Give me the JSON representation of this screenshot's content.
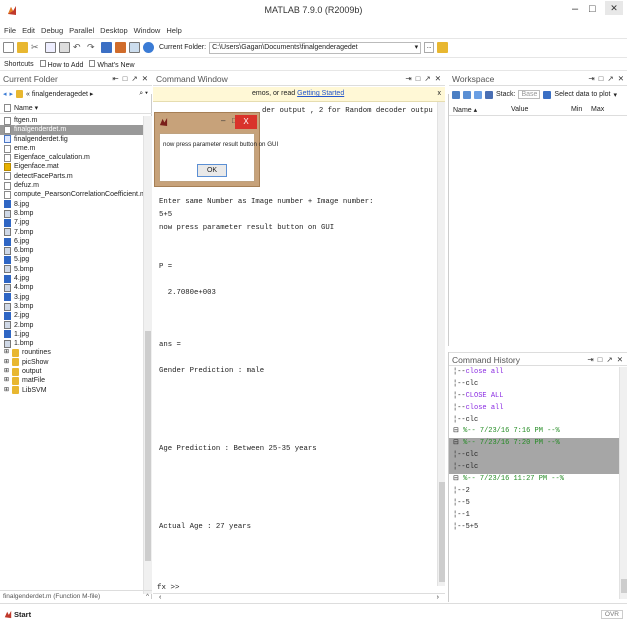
{
  "window": {
    "title": "MATLAB 7.9.0 (R2009b)",
    "controls": [
      "–",
      "□",
      "✕"
    ]
  },
  "menu": [
    "File",
    "Edit",
    "Debug",
    "Parallel",
    "Desktop",
    "Window",
    "Help"
  ],
  "toolbar": {
    "current_folder_label": "Current Folder:",
    "current_folder_value": "C:\\Users\\Gagan\\Documents\\finalgenderagedet",
    "browse_label": "..."
  },
  "shortcuts": [
    "Shortcuts",
    "How to Add",
    "What's New"
  ],
  "current_folder": {
    "title": "Current Folder",
    "breadcrumb": "« finalgenderagedet ▸",
    "name_header": "Name ▾",
    "files": [
      {
        "name": "ftgen.m",
        "type": "m"
      },
      {
        "name": "finalgenderdet.m",
        "type": "m",
        "selected": true
      },
      {
        "name": "finalgenderdet.fig",
        "type": "fig"
      },
      {
        "name": "eme.m",
        "type": "m"
      },
      {
        "name": "Eigenface_calculation.m",
        "type": "m"
      },
      {
        "name": "Eigenface.mat",
        "type": "mat"
      },
      {
        "name": "detectFaceParts.m",
        "type": "m"
      },
      {
        "name": "defuz.m",
        "type": "m"
      },
      {
        "name": "compute_PearsonCorrelationCoefficient.m",
        "type": "m"
      },
      {
        "name": "8.jpg",
        "type": "jpg"
      },
      {
        "name": "8.bmp",
        "type": "bmp"
      },
      {
        "name": "7.jpg",
        "type": "jpg"
      },
      {
        "name": "7.bmp",
        "type": "bmp"
      },
      {
        "name": "6.jpg",
        "type": "jpg"
      },
      {
        "name": "6.bmp",
        "type": "bmp"
      },
      {
        "name": "5.jpg",
        "type": "jpg"
      },
      {
        "name": "5.bmp",
        "type": "bmp"
      },
      {
        "name": "4.jpg",
        "type": "jpg"
      },
      {
        "name": "4.bmp",
        "type": "bmp"
      },
      {
        "name": "3.jpg",
        "type": "jpg"
      },
      {
        "name": "3.bmp",
        "type": "bmp"
      },
      {
        "name": "2.jpg",
        "type": "jpg"
      },
      {
        "name": "2.bmp",
        "type": "bmp"
      },
      {
        "name": "1.jpg",
        "type": "jpg"
      },
      {
        "name": "1.bmp",
        "type": "bmp"
      },
      {
        "name": "rountines",
        "type": "dir"
      },
      {
        "name": "picShow",
        "type": "dir"
      },
      {
        "name": "output",
        "type": "dir"
      },
      {
        "name": "matFile",
        "type": "dir"
      },
      {
        "name": "LibSVM",
        "type": "dir"
      }
    ],
    "status": "finalgenderdet.m (Function M-file)"
  },
  "command_window": {
    "title": "Command Window",
    "info_line": "emos, or read",
    "info_link": "Getting Started",
    "lines": [
      "der output , 2 for Random decoder output",
      "",
      "",
      "h =",
      "",
      "  2.7040e+003",
      "",
      "Enter same Number as Image number + Image number:",
      "5+5",
      "now press parameter result button on GUI",
      "",
      "",
      "P =",
      "",
      "  2.7080e+003",
      "",
      "",
      "",
      "ans =",
      "",
      "Gender Prediction : male",
      "",
      "",
      "",
      "",
      "",
      "Age Prediction : Between 25-35 years",
      "",
      "",
      "",
      "",
      "",
      "Actual Age : 27 years"
    ],
    "prompt": "fx >>"
  },
  "dialog": {
    "message": "now press parameter result button on GUI",
    "ok_label": "OK",
    "close_label": "X"
  },
  "workspace": {
    "title": "Workspace",
    "stack_label": "Stack:",
    "stack_value": "Base",
    "plot_label": "Select data to plot",
    "columns": [
      "Name ▴",
      "Value",
      "Min",
      "Max"
    ]
  },
  "history": {
    "title": "Command History",
    "rows": [
      {
        "text": "close all",
        "style": "cmd"
      },
      {
        "text": "clc",
        "style": "plain"
      },
      {
        "text": "CLOSE ALL",
        "style": "cmd"
      },
      {
        "text": "close all",
        "style": "cmd"
      },
      {
        "text": "clc",
        "style": "plain"
      },
      {
        "text": "%-- 7/23/16  7:16 PM --%",
        "style": "session"
      },
      {
        "text": "%-- 7/23/16  7:20 PM --%",
        "style": "session-sel"
      },
      {
        "text": "clc",
        "style": "sel"
      },
      {
        "text": "clc",
        "style": "sel"
      },
      {
        "text": "%-- 7/23/16 11:27 PM --%",
        "style": "session"
      },
      {
        "text": "2",
        "style": "plain"
      },
      {
        "text": "5",
        "style": "plain"
      },
      {
        "text": "1",
        "style": "plain"
      },
      {
        "text": "5+5",
        "style": "plain"
      }
    ]
  },
  "statusbar": {
    "start_label": "Start",
    "ovr": "OVR"
  }
}
